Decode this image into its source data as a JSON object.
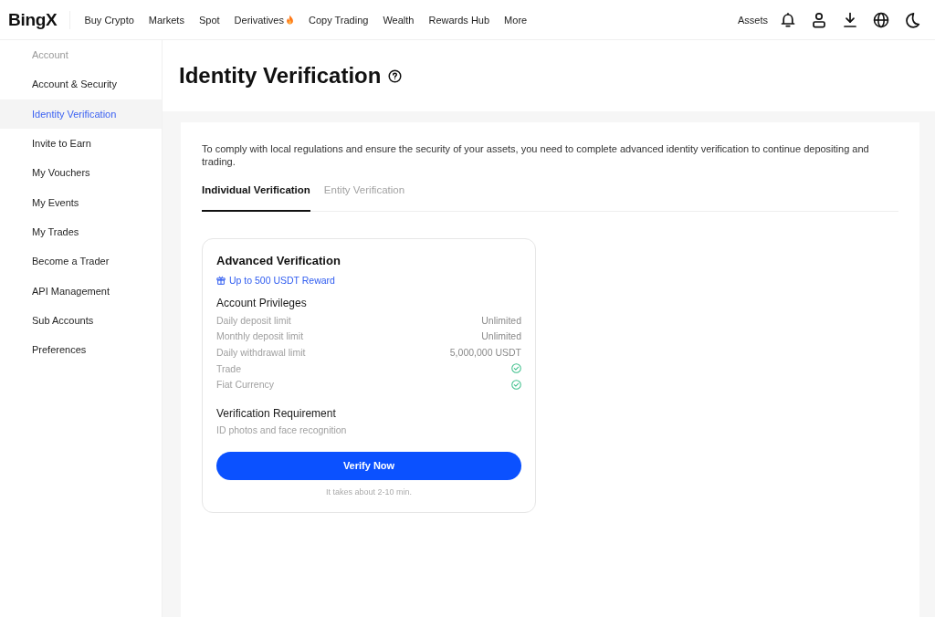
{
  "header": {
    "logo": "BingX",
    "nav": [
      {
        "label": "Buy Crypto",
        "hot": false
      },
      {
        "label": "Markets",
        "hot": false
      },
      {
        "label": "Spot",
        "hot": false
      },
      {
        "label": "Derivatives",
        "hot": true
      },
      {
        "label": "Copy Trading",
        "hot": false
      },
      {
        "label": "Wealth",
        "hot": false
      },
      {
        "label": "Rewards Hub",
        "hot": false
      },
      {
        "label": "More",
        "hot": false
      }
    ],
    "assets": "Assets"
  },
  "sidebar": {
    "heading": "Account",
    "items": [
      {
        "label": "Account & Security",
        "selected": false
      },
      {
        "label": "Identity Verification",
        "selected": true
      },
      {
        "label": "Invite to Earn",
        "selected": false
      },
      {
        "label": "My Vouchers",
        "selected": false
      },
      {
        "label": "My Events",
        "selected": false
      },
      {
        "label": "My Trades",
        "selected": false
      },
      {
        "label": "Become a Trader",
        "selected": false
      },
      {
        "label": "API Management",
        "selected": false
      },
      {
        "label": "Sub Accounts",
        "selected": false
      },
      {
        "label": "Preferences",
        "selected": false
      }
    ]
  },
  "page": {
    "title": "Identity Verification"
  },
  "panel": {
    "notice": "To comply with local regulations and ensure the security of your assets, you need to complete advanced identity verification to continue depositing and trading.",
    "tabs": [
      {
        "label": "Individual Verification",
        "selected": true
      },
      {
        "label": "Entity Verification",
        "selected": false
      }
    ],
    "card": {
      "title": "Advanced Verification",
      "reward": "Up to 500 USDT Reward",
      "privileges_title": "Account Privileges",
      "privileges": [
        {
          "kind": "text",
          "label": "Daily deposit limit",
          "value": "Unlimited"
        },
        {
          "kind": "text",
          "label": "Monthly deposit limit",
          "value": "Unlimited"
        },
        {
          "kind": "text",
          "label": "Daily withdrawal limit",
          "value": "5,000,000 USDT"
        },
        {
          "kind": "check",
          "label": "Trade"
        },
        {
          "kind": "check",
          "label": "Fiat Currency"
        }
      ],
      "requirement_title": "Verification Requirement",
      "requirement": "ID photos and face recognition",
      "button": "Verify Now",
      "note": "It takes about 2-10 min."
    }
  }
}
